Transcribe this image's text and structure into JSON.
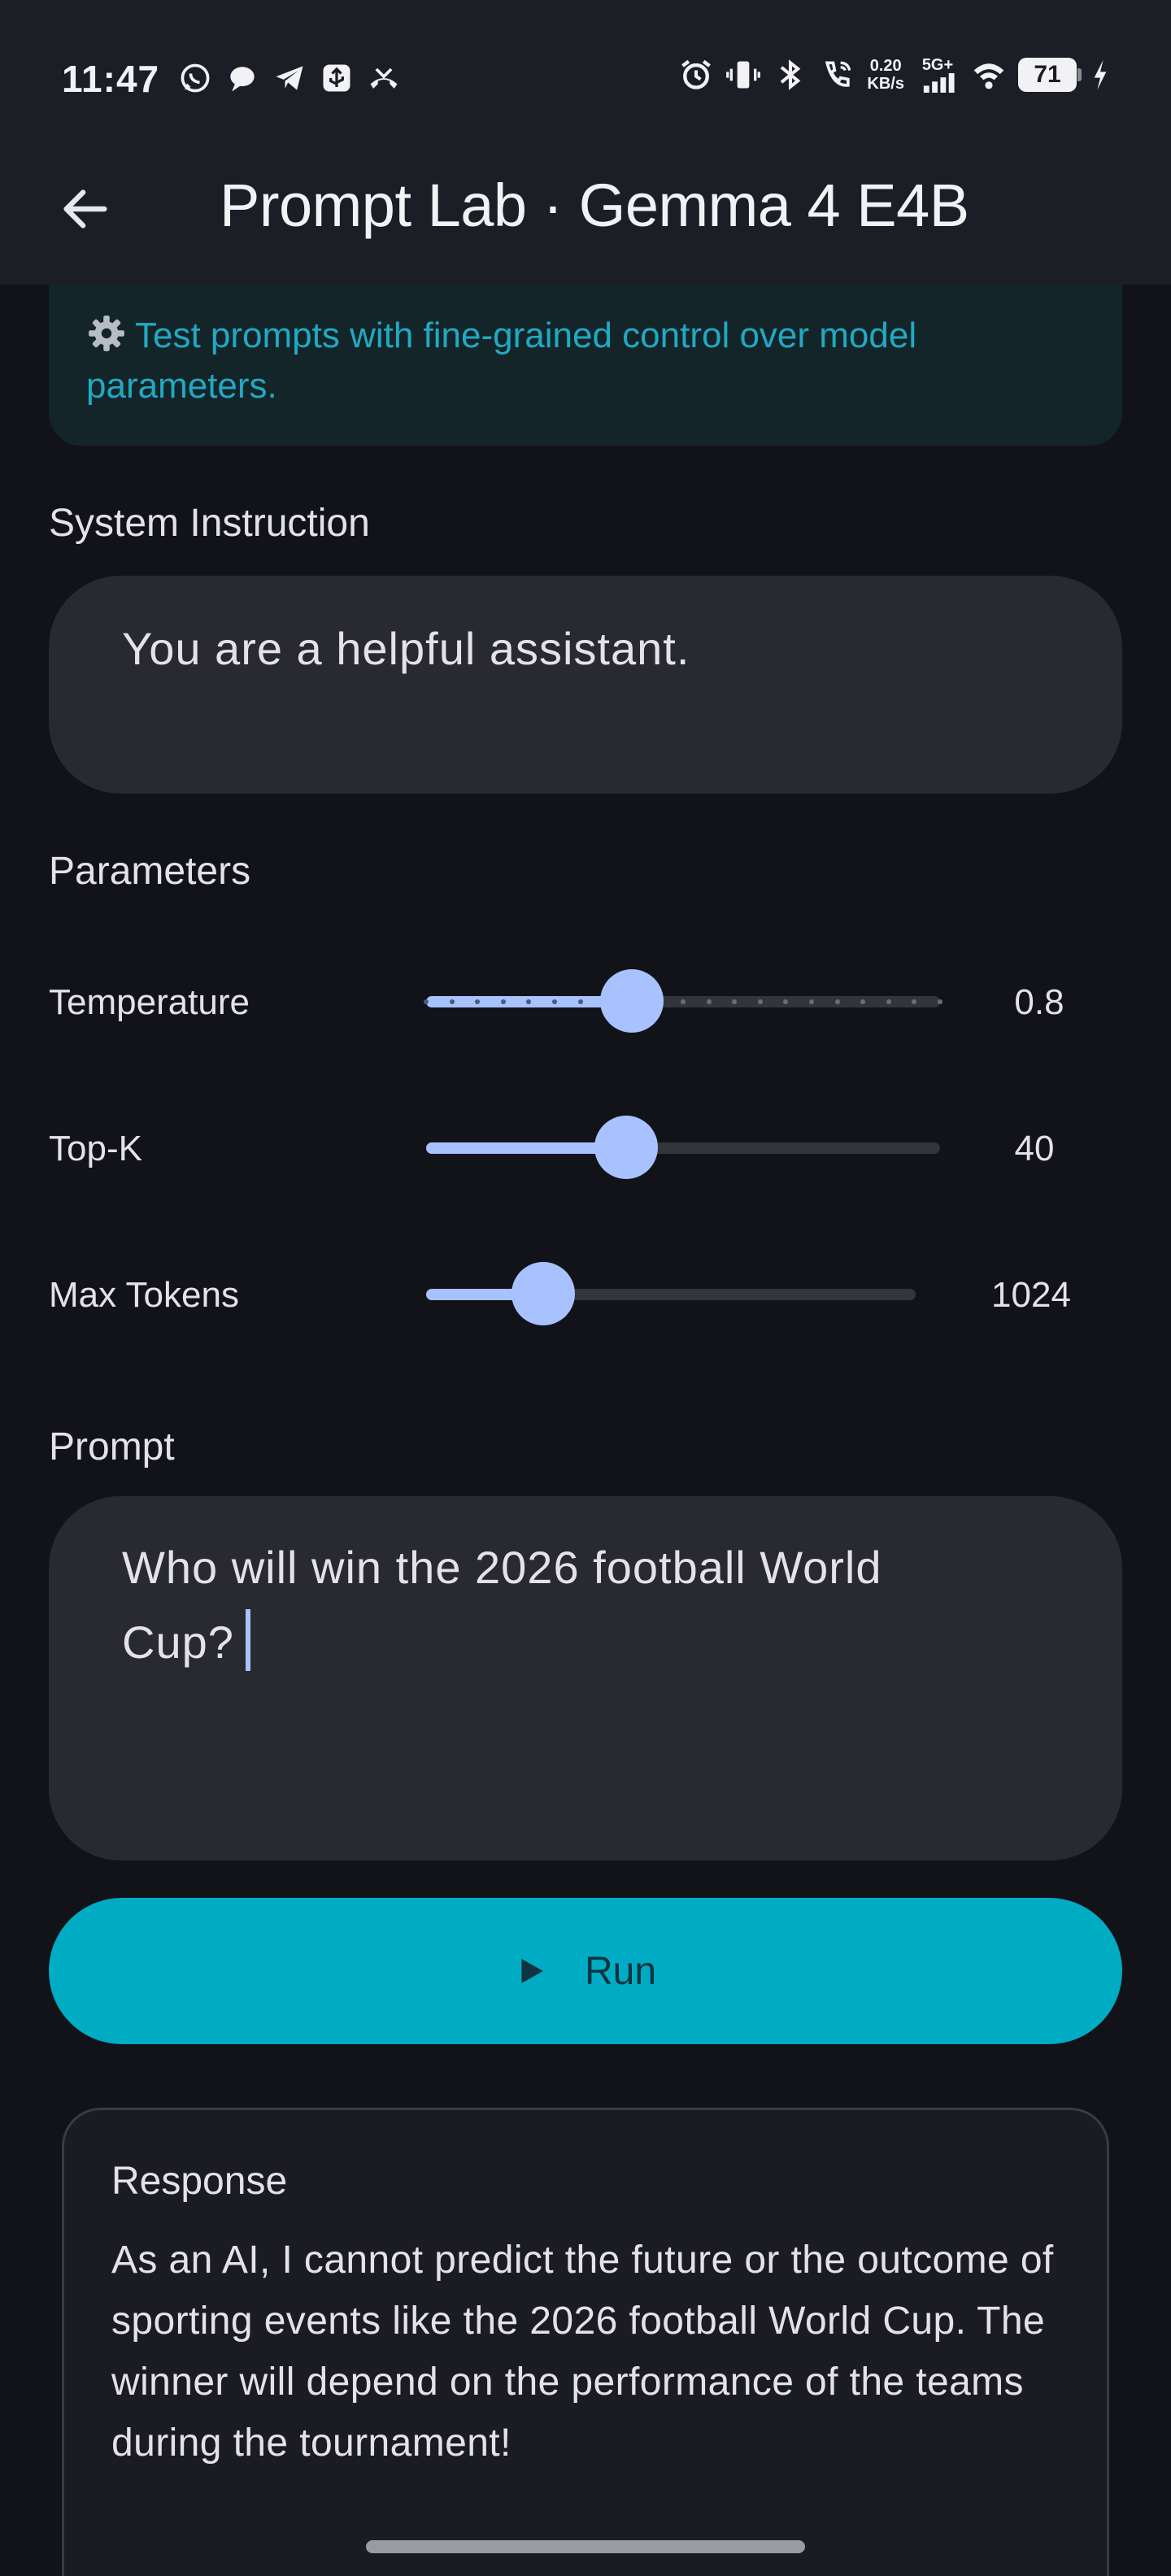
{
  "status_bar": {
    "time": "11:47",
    "notification_icons": [
      "whatsapp-icon",
      "chat-bubble-icon",
      "telegram-icon",
      "usb-icon",
      "missed-call-icon"
    ],
    "net_speed_value": "0.20",
    "net_speed_unit": "KB/s",
    "network": "5G+",
    "battery": "71"
  },
  "app_bar": {
    "title": "Prompt Lab · Gemma 4 E4B"
  },
  "info_banner": {
    "icon": "gear-icon",
    "text": "Test prompts with fine-grained control over model parameters."
  },
  "system_instruction": {
    "label": "System Instruction",
    "value": "You are a helpful assistant."
  },
  "parameters": {
    "label": "Parameters",
    "temperature": {
      "label": "Temperature",
      "value": "0.8",
      "fraction": 0.4
    },
    "top_k": {
      "label": "Top-K",
      "value": "40",
      "fraction": 0.39
    },
    "max_tokens": {
      "label": "Max Tokens",
      "value": "1024",
      "fraction": 0.24
    }
  },
  "prompt": {
    "label": "Prompt",
    "value": "Who will win the 2026 football World Cup?"
  },
  "run_button": {
    "label": "Run"
  },
  "response": {
    "title": "Response",
    "text": "As an AI, I cannot predict the future or the outcome of sporting events like the 2026 football World Cup. The winner will depend on the performance of the teams during the tournament!"
  },
  "colors": {
    "accent": "#a8c2ff",
    "run_button": "#00acc4",
    "banner_text": "#21a9c2",
    "background": "#121318"
  }
}
